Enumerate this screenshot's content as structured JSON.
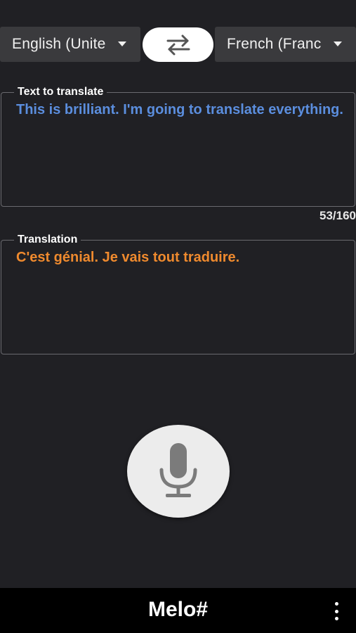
{
  "languages": {
    "source_label": "English (Unite",
    "target_label": "French (Franc"
  },
  "source": {
    "legend": "Text to translate",
    "text": "This is brilliant. I'm going to translate everything.",
    "char_count": "53/160"
  },
  "translation": {
    "legend": "Translation",
    "text": "C'est génial. Je vais tout traduire."
  },
  "bottom_bar": {
    "title": "Melo#"
  },
  "colors": {
    "background": "#202024",
    "source_text": "#5b8ede",
    "translation_text": "#ef8a2e",
    "select_bg": "#3a3a3d"
  },
  "icons": {
    "swap": "swap-arrows-icon",
    "mic": "microphone-icon",
    "menu": "more-vert-icon",
    "dropdown": "dropdown-caret-icon"
  }
}
